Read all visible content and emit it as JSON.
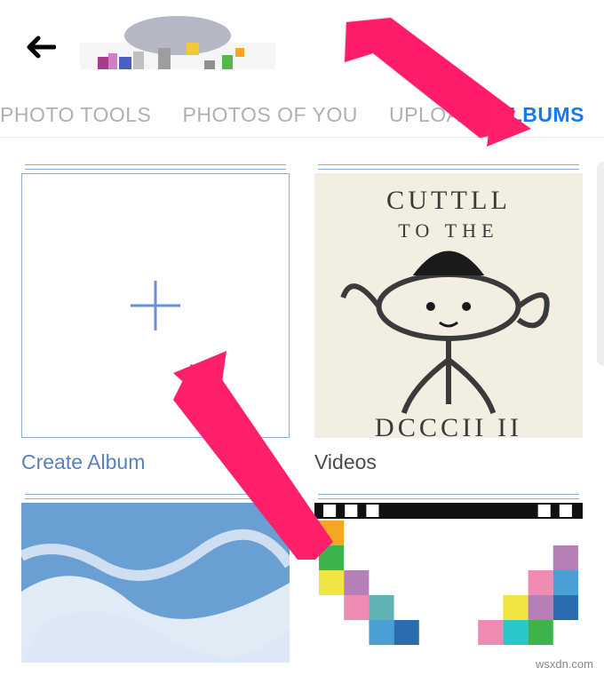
{
  "header": {
    "back_icon": "back-arrow"
  },
  "tabs": [
    {
      "label": "PHOTO TOOLS",
      "active": false
    },
    {
      "label": "PHOTOS OF YOU",
      "active": false
    },
    {
      "label": "UPLOADS",
      "active": false
    },
    {
      "label": "ALBUMS",
      "active": true
    }
  ],
  "albums": {
    "create_label": "Create Album",
    "videos_label": "Videos"
  },
  "annotation_color": "#ff1f6b",
  "watermark": "wsxdn.com"
}
